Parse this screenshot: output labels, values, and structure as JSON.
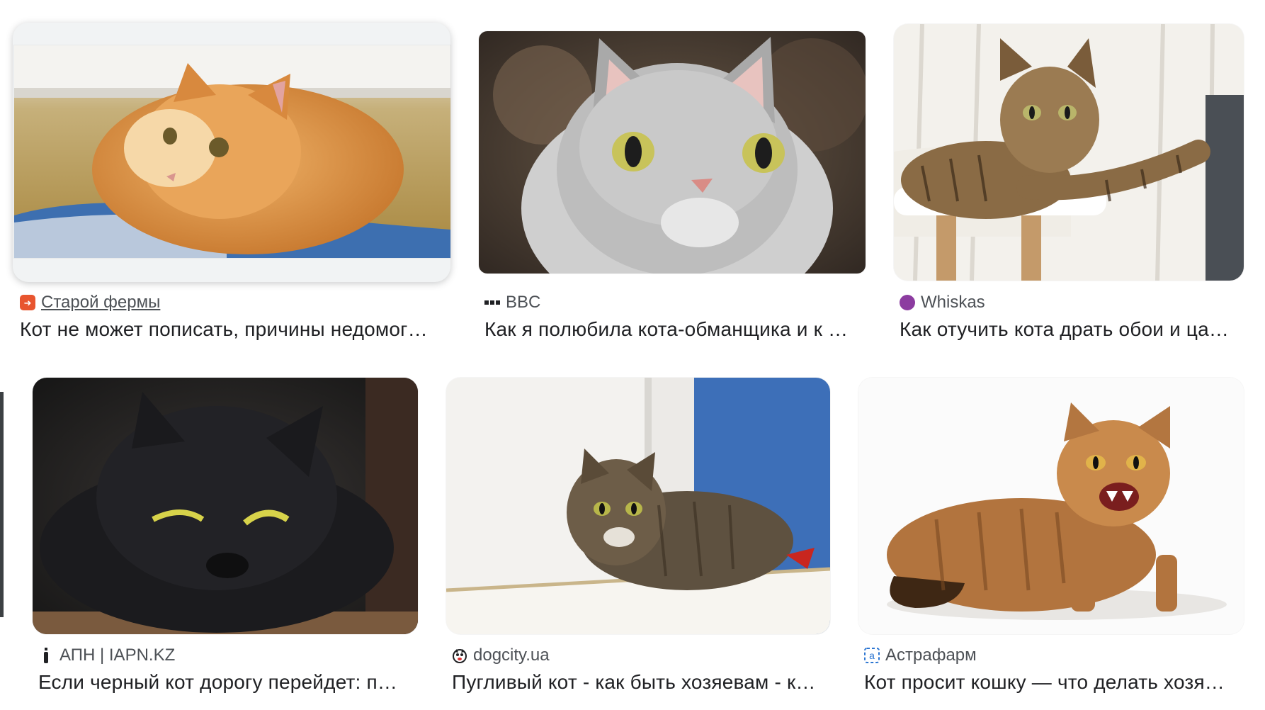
{
  "results": [
    {
      "source": "Старой фермы",
      "title": "Кот не может пописать, причины недомог…",
      "favicon": "farm-icon",
      "selected": true
    },
    {
      "source": "BBC",
      "title": "Как я полюбила кота-обманщика и к …",
      "favicon": "bbc-icon"
    },
    {
      "source": "Whiskas",
      "title": "Как отучить кота драть обои и ца…",
      "favicon": "whiskas-icon"
    },
    {
      "source": "АПН | IAPN.KZ",
      "title": "Если черный кот дорогу перейдет: п…",
      "favicon": "iapn-icon"
    },
    {
      "source": "dogcity.ua",
      "title": "Пугливый кот - как быть хозяевам - к…",
      "favicon": "dogcity-icon"
    },
    {
      "source": "Астрафарм",
      "title": "Кот просит кошку — что делать хозя…",
      "favicon": "astrafarm-icon"
    }
  ],
  "colors": {
    "farm": "#e8552f",
    "whiskas": "#8c3ca0",
    "text": "#202124",
    "muted": "#4d5156"
  }
}
